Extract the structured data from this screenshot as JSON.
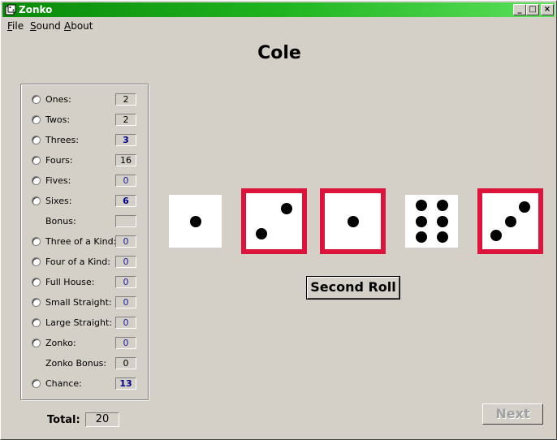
{
  "window": {
    "title": "Zonko"
  },
  "menu": [
    {
      "label_ul": "F",
      "label_rest": "ile"
    },
    {
      "label_ul": "S",
      "label_rest": "ound"
    },
    {
      "label_ul": "A",
      "label_rest": "bout"
    }
  ],
  "player_name": "Cole",
  "scorecard": [
    {
      "label": "Ones:",
      "score": "2",
      "radio": true,
      "style": "black"
    },
    {
      "label": "Twos:",
      "score": "2",
      "radio": true,
      "style": "black"
    },
    {
      "label": "Threes:",
      "score": "3",
      "radio": true,
      "style": "boldblue"
    },
    {
      "label": "Fours:",
      "score": "16",
      "radio": true,
      "style": "black"
    },
    {
      "label": "Fives:",
      "score": "0",
      "radio": true,
      "style": "blue"
    },
    {
      "label": "Sixes:",
      "score": "6",
      "radio": true,
      "style": "boldblue"
    },
    {
      "label": "Bonus:",
      "score": "",
      "radio": false,
      "style": "black"
    },
    {
      "label": "Three of a Kind:",
      "score": "0",
      "radio": true,
      "style": "blue"
    },
    {
      "label": "Four of a Kind:",
      "score": "0",
      "radio": true,
      "style": "blue"
    },
    {
      "label": "Full House:",
      "score": "0",
      "radio": true,
      "style": "blue"
    },
    {
      "label": "Small Straight:",
      "score": "0",
      "radio": true,
      "style": "blue"
    },
    {
      "label": "Large Straight:",
      "score": "0",
      "radio": true,
      "style": "blue"
    },
    {
      "label": "Zonko:",
      "score": "0",
      "radio": true,
      "style": "blue"
    },
    {
      "label": "Zonko Bonus:",
      "score": "0",
      "radio": false,
      "style": "black"
    },
    {
      "label": "Chance:",
      "score": "13",
      "radio": true,
      "style": "boldblue"
    }
  ],
  "dice": [
    {
      "value": 1,
      "held": false
    },
    {
      "value": 2,
      "held": true
    },
    {
      "value": 1,
      "held": true
    },
    {
      "value": 6,
      "held": false
    },
    {
      "value": 3,
      "held": true
    }
  ],
  "colors": {
    "held_border": "#dc143c",
    "title_green": "#1fb41f"
  },
  "buttons": {
    "roll": "Second Roll",
    "next": "Next"
  },
  "total": {
    "label": "Total:",
    "value": "20"
  }
}
